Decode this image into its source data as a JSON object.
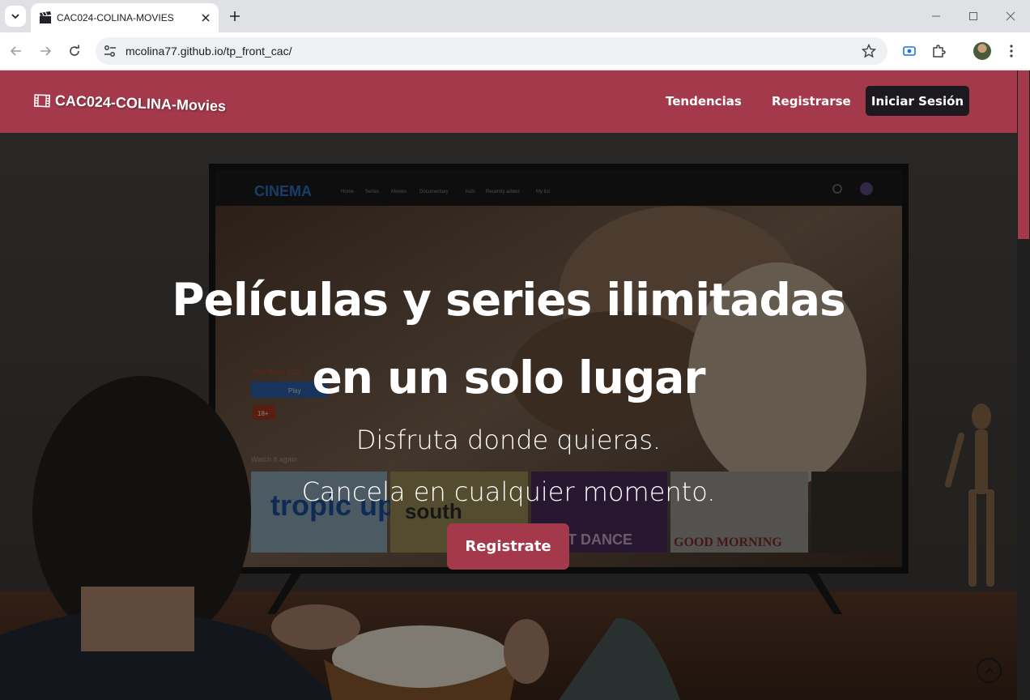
{
  "browser": {
    "tab_title": "CAC024-COLINA-MOVIES",
    "url": "mcolina77.github.io/tp_front_cac/"
  },
  "header": {
    "brand": "CAC024-COLINA-Movies",
    "nav": [
      "Tendencias",
      "Registrarse"
    ],
    "login_label": "Iniciar Sesión"
  },
  "hero": {
    "title_line1": "Películas y series ilimitadas",
    "title_line2": "en un solo lugar",
    "subtitle_line1": "Disfruta donde quieras.",
    "subtitle_line2": "Cancela en cualquier momento.",
    "cta_label": "Registrate"
  },
  "tv_screen": {
    "logo": "CINEMA",
    "menu": [
      "Home",
      "Series",
      "Movies",
      "Documentary",
      "Kids",
      "Recently added",
      "My list"
    ],
    "row_label": "Watch it again",
    "play_label": "Play",
    "meta": "95% Match  2021",
    "rating": "18+",
    "thumbnails": [
      "tropic up",
      "south",
      "FIRST DANCE",
      "GOOD MORNING",
      ""
    ]
  },
  "colors": {
    "brand": "#a3394b",
    "login_bg": "#1d1a1f"
  }
}
